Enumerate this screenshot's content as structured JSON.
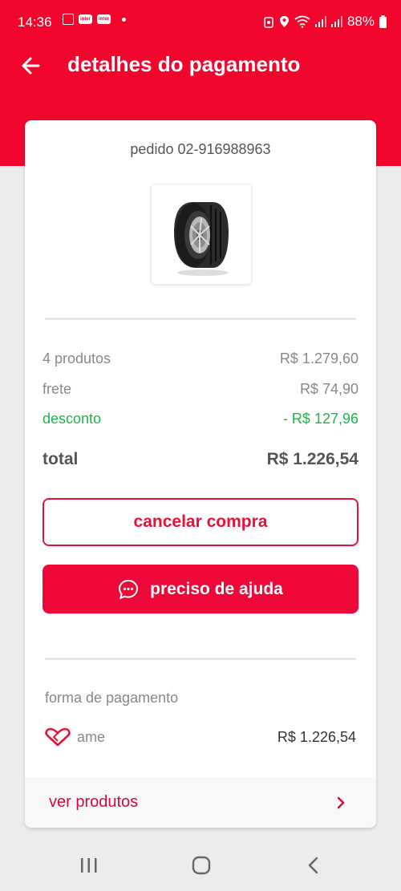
{
  "status_bar": {
    "time": "14:36",
    "badge_1": "inter",
    "badge_2": "inter",
    "battery": "88%"
  },
  "header": {
    "title": "detalhes do pagamento"
  },
  "order": {
    "id_label": "pedido 02-916988963"
  },
  "summary": {
    "products_label": "4 produtos",
    "products_value": "R$ 1.279,60",
    "shipping_label": "frete",
    "shipping_value": "R$ 74,90",
    "discount_label": "desconto",
    "discount_value": "- R$ 127,96",
    "total_label": "total",
    "total_value": "R$ 1.226,54"
  },
  "actions": {
    "cancel_label": "cancelar compra",
    "help_label": "preciso de ajuda"
  },
  "payment": {
    "section_label": "forma de pagamento",
    "method_name": "ame",
    "method_icon": "heart-icon",
    "amount": "R$ 1.226,54"
  },
  "footer": {
    "link_label": "ver produtos"
  },
  "colors": {
    "brand": "#f2052c",
    "discount": "#22b14c"
  }
}
